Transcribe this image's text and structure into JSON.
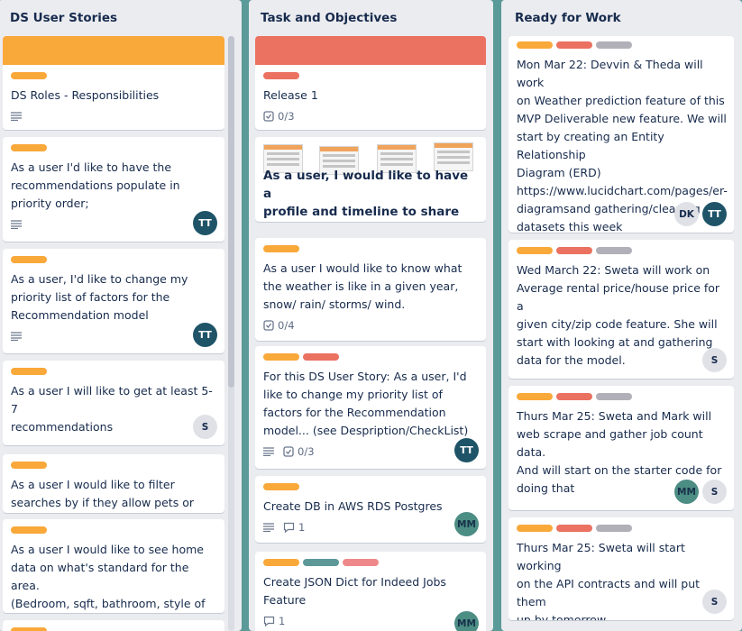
{
  "colors": {
    "board_bg": "#5a9a98",
    "list_bg": "#ebecf0",
    "label_orange": "#f9a83a",
    "label_red": "#eb7160",
    "label_grey": "#b1b0b8",
    "label_teal": "#5d9898",
    "label_pink": "#ef8989",
    "cover_orange": "#f9a83a",
    "cover_red": "#eb7160"
  },
  "lists": [
    {
      "title": "DS User Stories",
      "cards": [
        {
          "title": "DS Roles - Responsibilities"
        },
        {
          "title": "As a user I'd like to have the\nrecommendations populate in\npriority order;",
          "members": [
            "TT"
          ]
        },
        {
          "title": "As a user, I'd like to change my\npriority list of factors for the\nRecommendation model",
          "members": [
            "TT"
          ]
        },
        {
          "title": "As a user I will like to get at least 5-7\nrecommendations",
          "members": [
            "S"
          ]
        },
        {
          "title": "As a user I would like to filter\nsearches by if they allow pets or not."
        },
        {
          "title": "As a user I would like to see home\ndata on what's standard for the area.\n(Bedroom, sqft, bathroom, style of\nhome)"
        }
      ]
    },
    {
      "title": "Task and Objectives",
      "cards": [
        {
          "title": "Release 1",
          "checklist": "0/3"
        },
        {
          "title": "As a user, I would like to have a\nprofile and timeline to share my\nexperiences."
        },
        {
          "title": "As a user I would like to know what\nthe weather is like in a given year,\nsnow/ rain/ storms/ wind.",
          "checklist": "0/4"
        },
        {
          "title": "For this DS User Story: As a user, I'd\nlike to change my priority list of\nfactors for the Recommendation\nmodel... (see Despription/CheckList)",
          "checklist": "0/3",
          "members": [
            "TT"
          ]
        },
        {
          "title": "Create DB in AWS RDS Postgres",
          "comments": "1",
          "members": [
            "MM"
          ]
        },
        {
          "title": "Create JSON Dict for Indeed Jobs\nFeature",
          "comments": "1",
          "members": [
            "MM"
          ]
        }
      ]
    },
    {
      "title": "Ready for Work",
      "cards": [
        {
          "title": "Mon Mar 22: Devvin & Theda will work\non Weather prediction feature of this\nMVP Deliverable new feature. We will\nstart by creating an Entity Relationship\nDiagram (ERD)\nhttps://www.lucidchart.com/pages/er-\ndiagramsand gathering/cleaning\ndatasets this week",
          "members": [
            "DK",
            "TT"
          ]
        },
        {
          "title": "Wed March 22: Sweta will work on\nAverage rental price/house price for a\ngiven city/zip code feature. She will\nstart with looking at and gathering\ndata for the model.",
          "members": [
            "S"
          ]
        },
        {
          "title": "Thurs Mar 25: Sweta and Mark will\nweb scrape and gather job count data.\nAnd will start on the starter code for\ndoing that",
          "members": [
            "MM",
            "S"
          ]
        },
        {
          "title": "Thurs Mar 25: Sweta will start working\non the API contracts and will put them\nup by tomorrow.",
          "members": [
            "S"
          ]
        }
      ]
    }
  ]
}
